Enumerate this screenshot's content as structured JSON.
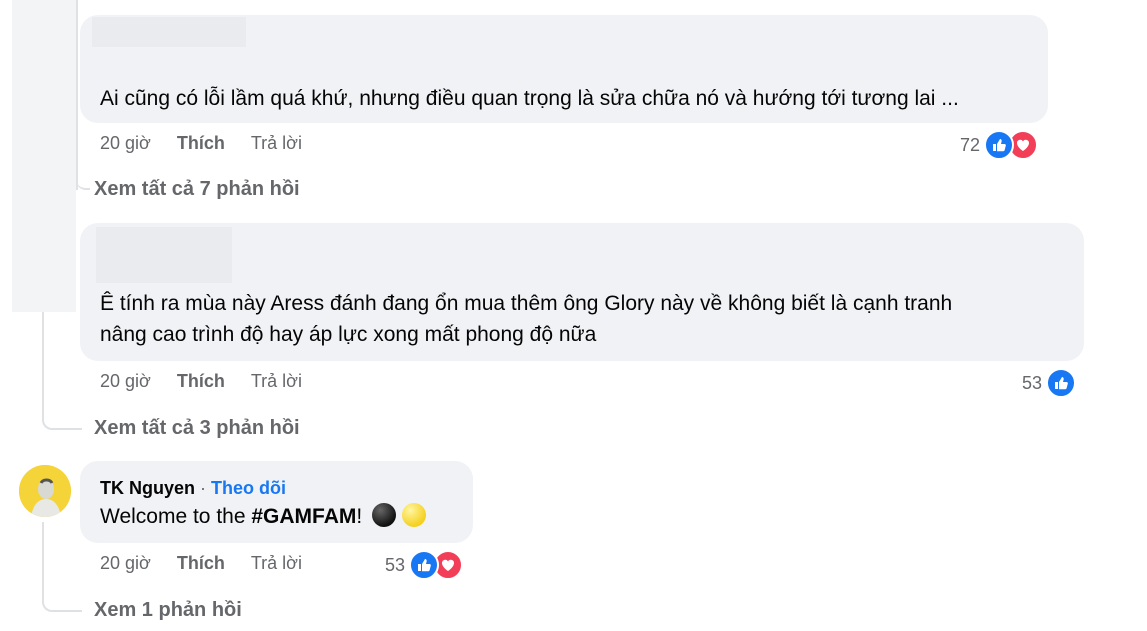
{
  "comments": [
    {
      "text": "Ai cũng có lỗi lầm quá khứ, nhưng điều quan trọng là sửa chữa nó và hướng tới tương lai ...",
      "time": "20 giờ",
      "like_label": "Thích",
      "reply_label": "Trả lời",
      "reaction_count": "72",
      "reactions": [
        "like-icon",
        "love-icon"
      ],
      "view_replies": "Xem tất cả 7 phản hồi"
    },
    {
      "text_line1": "Ê tính ra mùa này Aress đánh đang ổn mua thêm ông Glory này về không biết là cạnh tranh",
      "text_line2": "nâng cao trình độ hay áp lực xong mất phong độ nữa",
      "time": "20 giờ",
      "like_label": "Thích",
      "reply_label": "Trả lời",
      "reaction_count": "53",
      "reactions": [
        "like-icon"
      ],
      "view_replies": "Xem tất cả 3 phản hồi"
    },
    {
      "author": "TK Nguyen",
      "separator": "·",
      "follow_label": "Theo dõi",
      "text_prefix": "Welcome to the ",
      "hashtag": "#GAMFAM",
      "text_suffix": "!",
      "emojis": [
        "black-circle-emoji",
        "yellow-circle-emoji"
      ],
      "time": "20 giờ",
      "like_label": "Thích",
      "reply_label": "Trả lời",
      "reaction_count": "53",
      "reactions": [
        "like-icon",
        "love-icon"
      ],
      "view_replies": "Xem 1 phản hồi"
    }
  ],
  "colors": {
    "bubble": "#f0f2f5",
    "meta": "#65676b",
    "link": "#1877f2",
    "like": "#1877f2",
    "love": "#f33e58"
  }
}
